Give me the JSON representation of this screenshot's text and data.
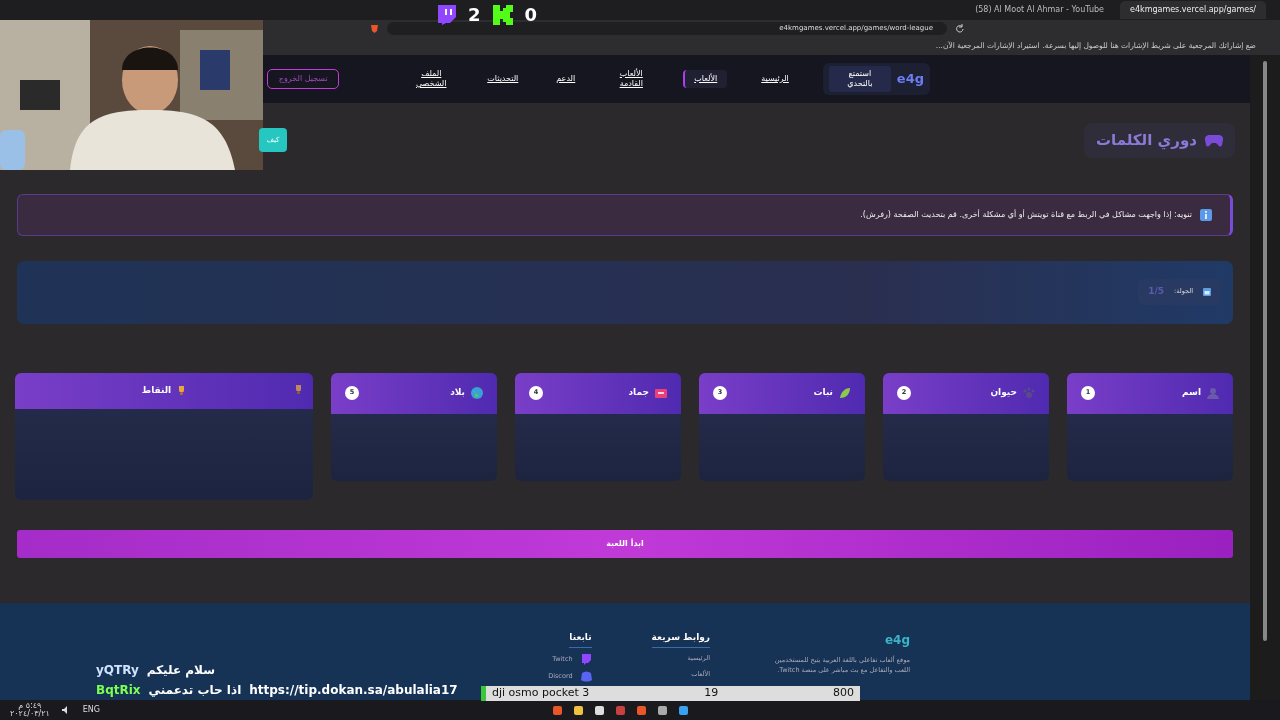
{
  "browser": {
    "tabs": [
      {
        "label": "e4kmgames.vercel.app/games/",
        "selected": true
      },
      {
        "label": "(58) Al Moot Al Ahmar - YouTube",
        "selected": false
      }
    ],
    "url": "e4kmgames.vercel.app/games/word-league",
    "bookmark_hint": "ضع إشاراتك المرجعية على شريط الإشارات هنا للوصول إليها بسرعة.",
    "bookmark_link": "استيراد الإشارات المرجعية الآن..."
  },
  "scoreboard": {
    "twitch_score": "2",
    "kick_score": "0"
  },
  "nav": {
    "logo": "e4g",
    "tagline": "استمتع بالتحدي",
    "items": [
      {
        "label": "الرئيسية",
        "selected": false
      },
      {
        "label": "الألعاب",
        "selected": true
      },
      {
        "label": "الألعاب القادمة",
        "selected": false
      },
      {
        "label": "الدعم",
        "selected": false
      },
      {
        "label": "التحديثات",
        "selected": false
      },
      {
        "label": "الملف الشخصي",
        "selected": false
      }
    ],
    "logout": "تسجيل الخروج"
  },
  "help_button": "كيف",
  "title": "دوري الكلمات",
  "notice": "تنويه: إذا واجهت مشاكل في الربط مع قناة تويتش أو أي مشكلة أخرى. قم بتحديث الصفحة (رفرش).",
  "round": {
    "label": "الجولة:",
    "value": "1/5"
  },
  "categories": [
    {
      "name": "اسم",
      "number": "1"
    },
    {
      "name": "حيوان",
      "number": "2"
    },
    {
      "name": "نبات",
      "number": "3"
    },
    {
      "name": "جماد",
      "number": "4"
    },
    {
      "name": "بلاد",
      "number": "5"
    }
  ],
  "points": {
    "title": "النقاط"
  },
  "start_button": "ابدأ اللعبة",
  "footer": {
    "logo": "e4g",
    "about": "موقع ألعاب تفاعلي باللغة العربية يتيح للمستخدمين اللعب والتفاعل مع بث مباشر على منصة Twitch.",
    "links_title": "روابط سريعة",
    "links": [
      "الرئيسية",
      "الألعاب"
    ],
    "follow_title": "تابعنا",
    "social": [
      "Twitch",
      "Discord"
    ]
  },
  "chat": [
    {
      "user": "yQTRy",
      "message": "سلام عليكم",
      "color": "#cfe3ff"
    },
    {
      "user": "BqtRix",
      "message": "اذا حاب تدعمني",
      "link": "https://tip.dokan.sa/abulalia17",
      "color": "#7cff4f"
    }
  ],
  "overlay": {
    "item": "dji osmo pocket 3",
    "count": "19",
    "price": "800"
  },
  "taskbar": {
    "language": "ENG",
    "time": "٥:٤٩ م",
    "date": "٢٠٢٤/٠٣/٢١"
  }
}
